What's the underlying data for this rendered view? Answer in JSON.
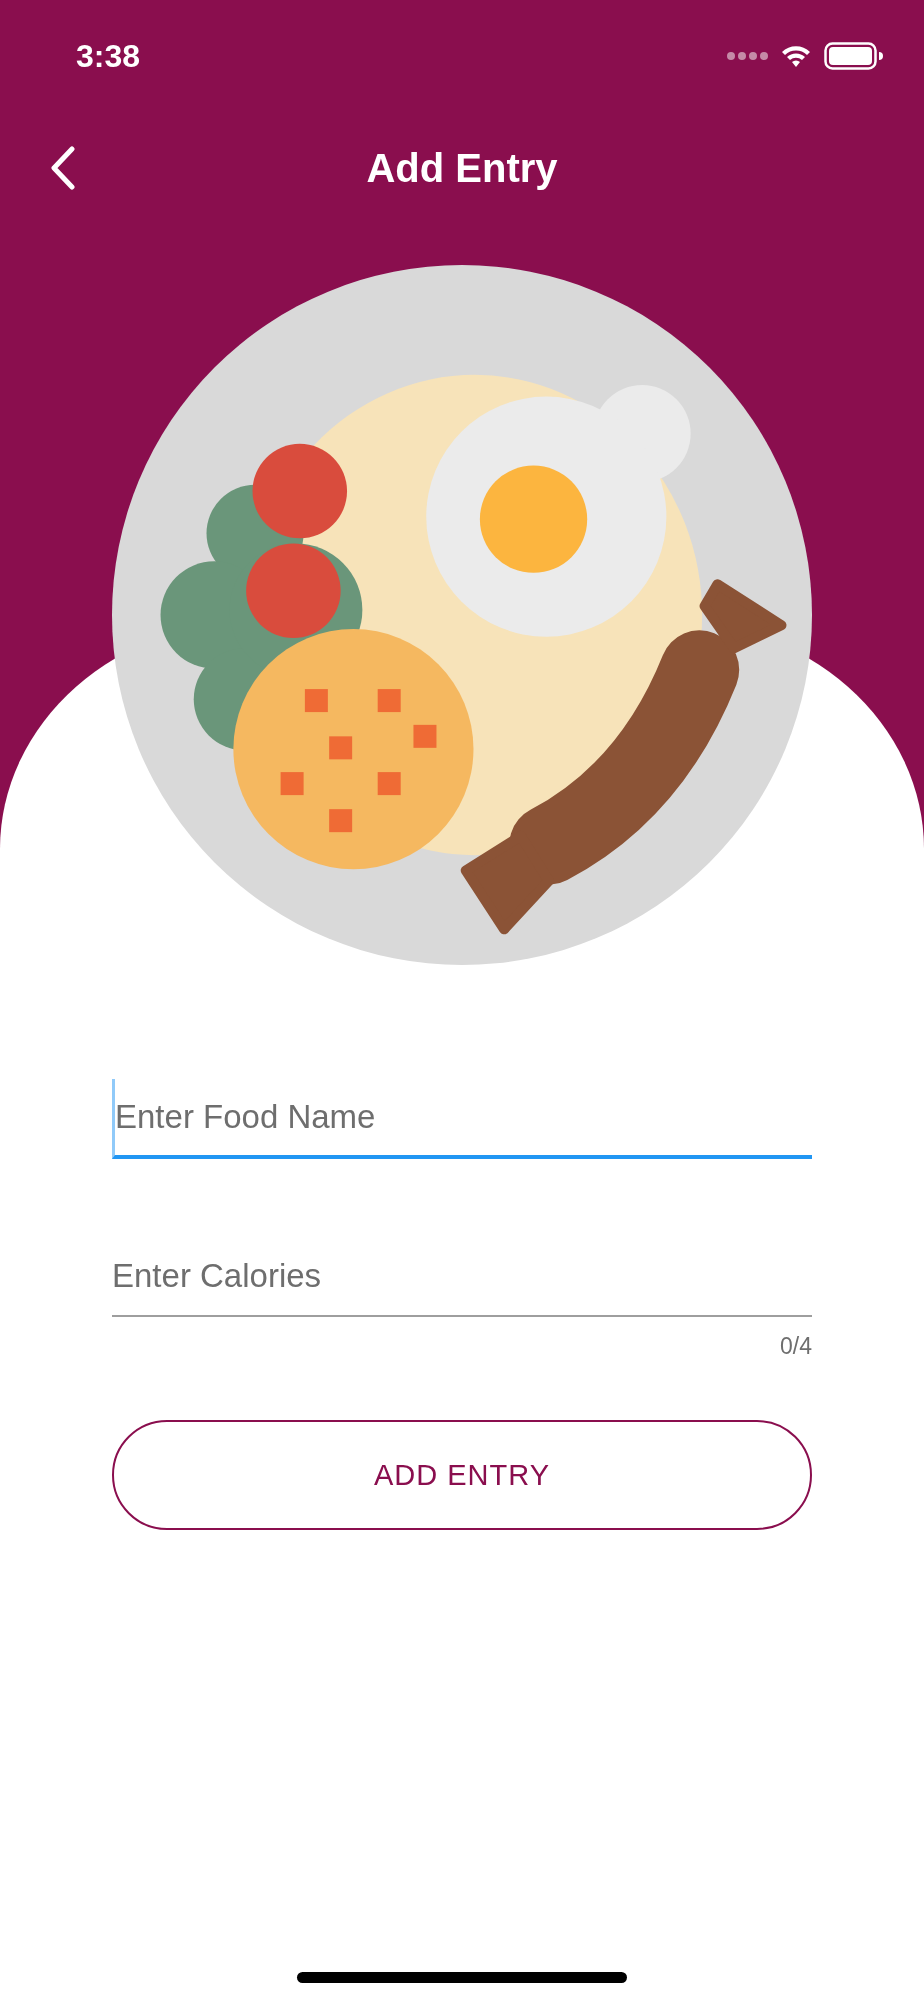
{
  "status_bar": {
    "time": "3:38"
  },
  "nav": {
    "title": "Add Entry"
  },
  "fields": [
    {
      "placeholder": "Enter Food Name",
      "focused": true
    },
    {
      "placeholder": "Enter Calories",
      "focused": false,
      "counter": "0/4"
    }
  ],
  "button": {
    "label": "ADD ENTRY"
  }
}
